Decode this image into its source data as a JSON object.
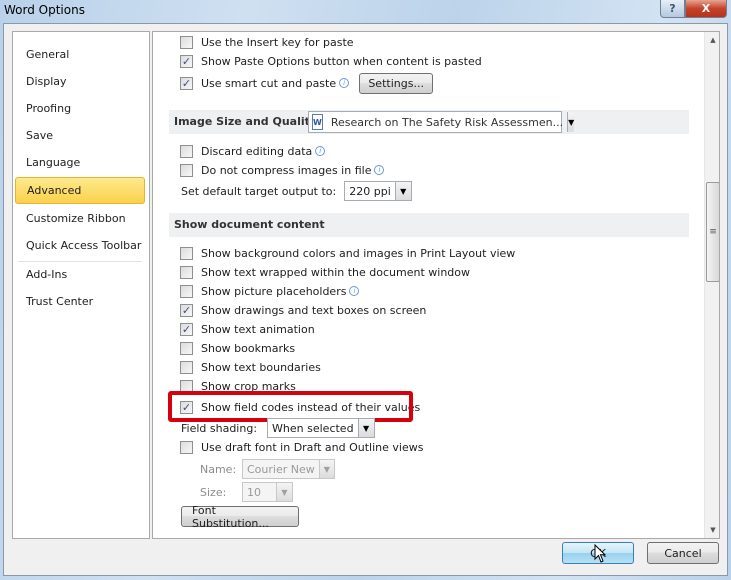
{
  "window": {
    "title": "Word Options",
    "help_label": "?",
    "close_label": "X"
  },
  "sidebar": {
    "items": [
      {
        "label": "General",
        "active": false
      },
      {
        "label": "Display",
        "active": false
      },
      {
        "label": "Proofing",
        "active": false
      },
      {
        "label": "Save",
        "active": false
      },
      {
        "label": "Language",
        "active": false
      },
      {
        "label": "Advanced",
        "active": true
      },
      {
        "label": "Customize Ribbon",
        "active": false
      },
      {
        "label": "Quick Access Toolbar",
        "active": false
      },
      {
        "label": "Add-Ins",
        "active": false
      },
      {
        "label": "Trust Center",
        "active": false
      }
    ]
  },
  "paste_options": {
    "insert_key": {
      "label": "Use the Insert key for paste",
      "checked": false
    },
    "show_paste_options": {
      "label": "Show Paste Options button when content is pasted",
      "checked": true
    },
    "smart_cut": {
      "label": "Use smart cut and paste",
      "checked": true
    },
    "settings_button": "Settings..."
  },
  "image_size_quality": {
    "heading": "Image Size and Quality",
    "document_select": "Research on The Safety Risk Assessmen...",
    "discard_editing": {
      "label": "Discard editing data",
      "checked": false
    },
    "no_compress": {
      "label": "Do not compress images in file",
      "checked": false
    },
    "target_output_label": "Set default target output to:",
    "target_output_value": "220 ppi"
  },
  "show_document_content": {
    "heading": "Show document content",
    "options": [
      {
        "label": "Show background colors and images in Print Layout view",
        "checked": false
      },
      {
        "label": "Show text wrapped within the document window",
        "checked": false
      },
      {
        "label": "Show picture placeholders",
        "checked": false,
        "info": true
      },
      {
        "label": "Show drawings and text boxes on screen",
        "checked": true
      },
      {
        "label": "Show text animation",
        "checked": true
      },
      {
        "label": "Show bookmarks",
        "checked": false
      },
      {
        "label": "Show text boundaries",
        "checked": false
      },
      {
        "label": "Show crop marks",
        "checked": false
      },
      {
        "label": "Show field codes instead of their values",
        "checked": true
      }
    ],
    "field_shading_label": "Field shading:",
    "field_shading_value": "When selected",
    "draft_font": {
      "label": "Use draft font in Draft and Outline views",
      "checked": false
    },
    "name_label": "Name:",
    "name_value": "Courier New",
    "size_label": "Size:",
    "size_value": "10",
    "font_substitution_button": "Font Substitution..."
  },
  "footer": {
    "ok": "OK",
    "cancel": "Cancel"
  },
  "colors": {
    "highlight_border": "#d6000f",
    "active_nav": "#fbd14b"
  }
}
